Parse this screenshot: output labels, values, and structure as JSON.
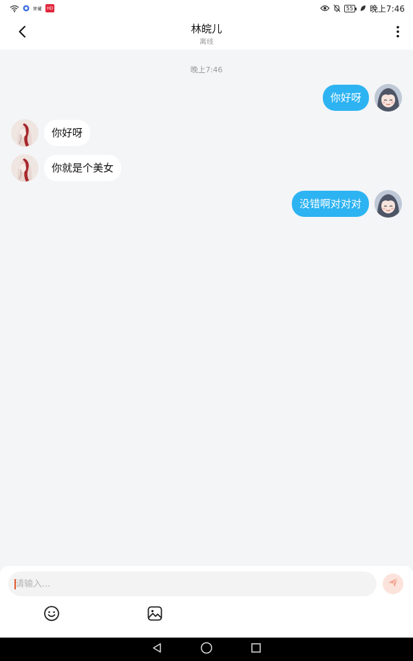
{
  "status_bar": {
    "time": "晚上7:46",
    "battery": "55",
    "left_small_text": "荣耀",
    "left_badge": "HD"
  },
  "header": {
    "title": "林皖儿",
    "subtitle": "离线"
  },
  "chat": {
    "timestamp": "晚上7:46",
    "messages": [
      {
        "side": "right",
        "text": "你好呀"
      },
      {
        "side": "left",
        "text": "你好呀"
      },
      {
        "side": "left",
        "text": "你就是个美女"
      },
      {
        "side": "right",
        "text": "没错啊对对对"
      }
    ]
  },
  "input": {
    "placeholder": "请输入..."
  },
  "icons": {
    "back": "back-arrow-icon",
    "more": "more-vertical-icon",
    "send": "send-icon",
    "emoji": "emoji-icon",
    "image": "image-icon"
  },
  "colors": {
    "my_bubble": "#2db3f2",
    "their_bubble": "#ffffff",
    "chat_background": "#f4f5f7",
    "send_button": "#fbe3dc",
    "send_icon": "#f4a48f"
  }
}
